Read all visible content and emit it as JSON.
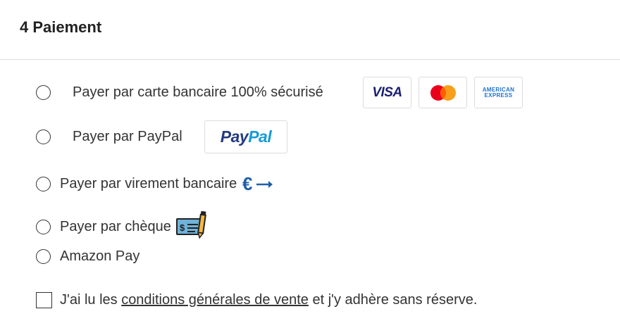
{
  "section": {
    "title": "4 Paiement"
  },
  "payment_options": {
    "card": {
      "label": "Payer par carte bancaire 100% sécurisé",
      "logos": {
        "visa": "VISA",
        "mastercard_icon": "mastercard-logo",
        "amex_line1": "AMERICAN",
        "amex_line2": "EXPRESS"
      }
    },
    "paypal": {
      "label": "Payer par PayPal",
      "logo_part1": "Pay",
      "logo_part2": "Pal"
    },
    "transfer": {
      "label": "Payer par virement bancaire",
      "icon": "euro-transfer-icon"
    },
    "cheque": {
      "label": "Payer par chèque",
      "icon": "cheque-icon"
    },
    "amazon": {
      "label": "Amazon Pay"
    }
  },
  "terms": {
    "prefix": "J'ai lu les ",
    "link": "conditions générales de vente",
    "suffix": " et j'y adhère sans réserve."
  },
  "colors": {
    "visa": "#1a1f71",
    "mastercard_red": "#eb001b",
    "mastercard_orange": "#f79e1b",
    "amex": "#1f72cd",
    "paypal_dark": "#253b80",
    "paypal_light": "#179bd7",
    "euro_icon": "#1f5fa8"
  }
}
